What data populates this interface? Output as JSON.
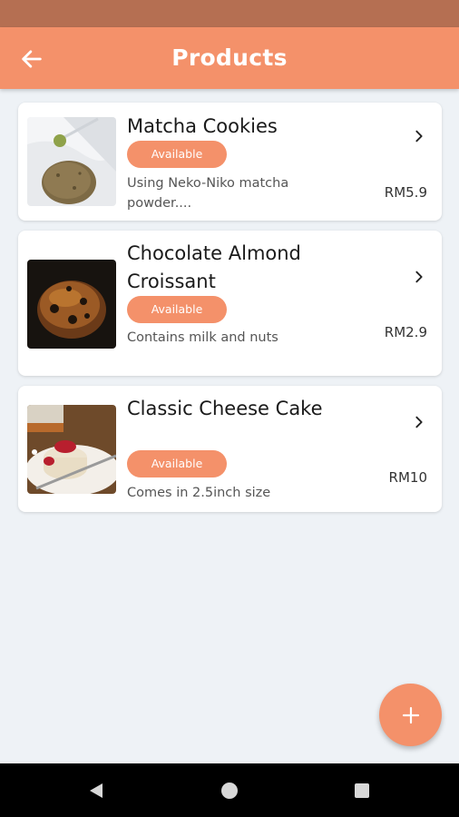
{
  "header": {
    "title": "Products"
  },
  "products": [
    {
      "name": "Matcha Cookies",
      "status": "Available",
      "description": "Using Neko-Niko matcha powder....",
      "price": "RM5.9"
    },
    {
      "name": "Chocolate Almond Croissant",
      "status": "Available",
      "description": "Contains milk and nuts",
      "price": "RM2.9"
    },
    {
      "name": "Classic Cheese Cake",
      "status": "Available",
      "description": "Comes in 2.5inch size",
      "price": "RM10"
    }
  ],
  "icons": {
    "back": "arrow-left-icon",
    "chevron": "chevron-right-icon",
    "add": "plus-icon",
    "nav_back": "triangle-back-icon",
    "nav_home": "circle-home-icon",
    "nav_recents": "square-recents-icon"
  },
  "colors": {
    "accent": "#f4916a",
    "status_bar": "#b56f52",
    "background": "#eef2f6"
  }
}
